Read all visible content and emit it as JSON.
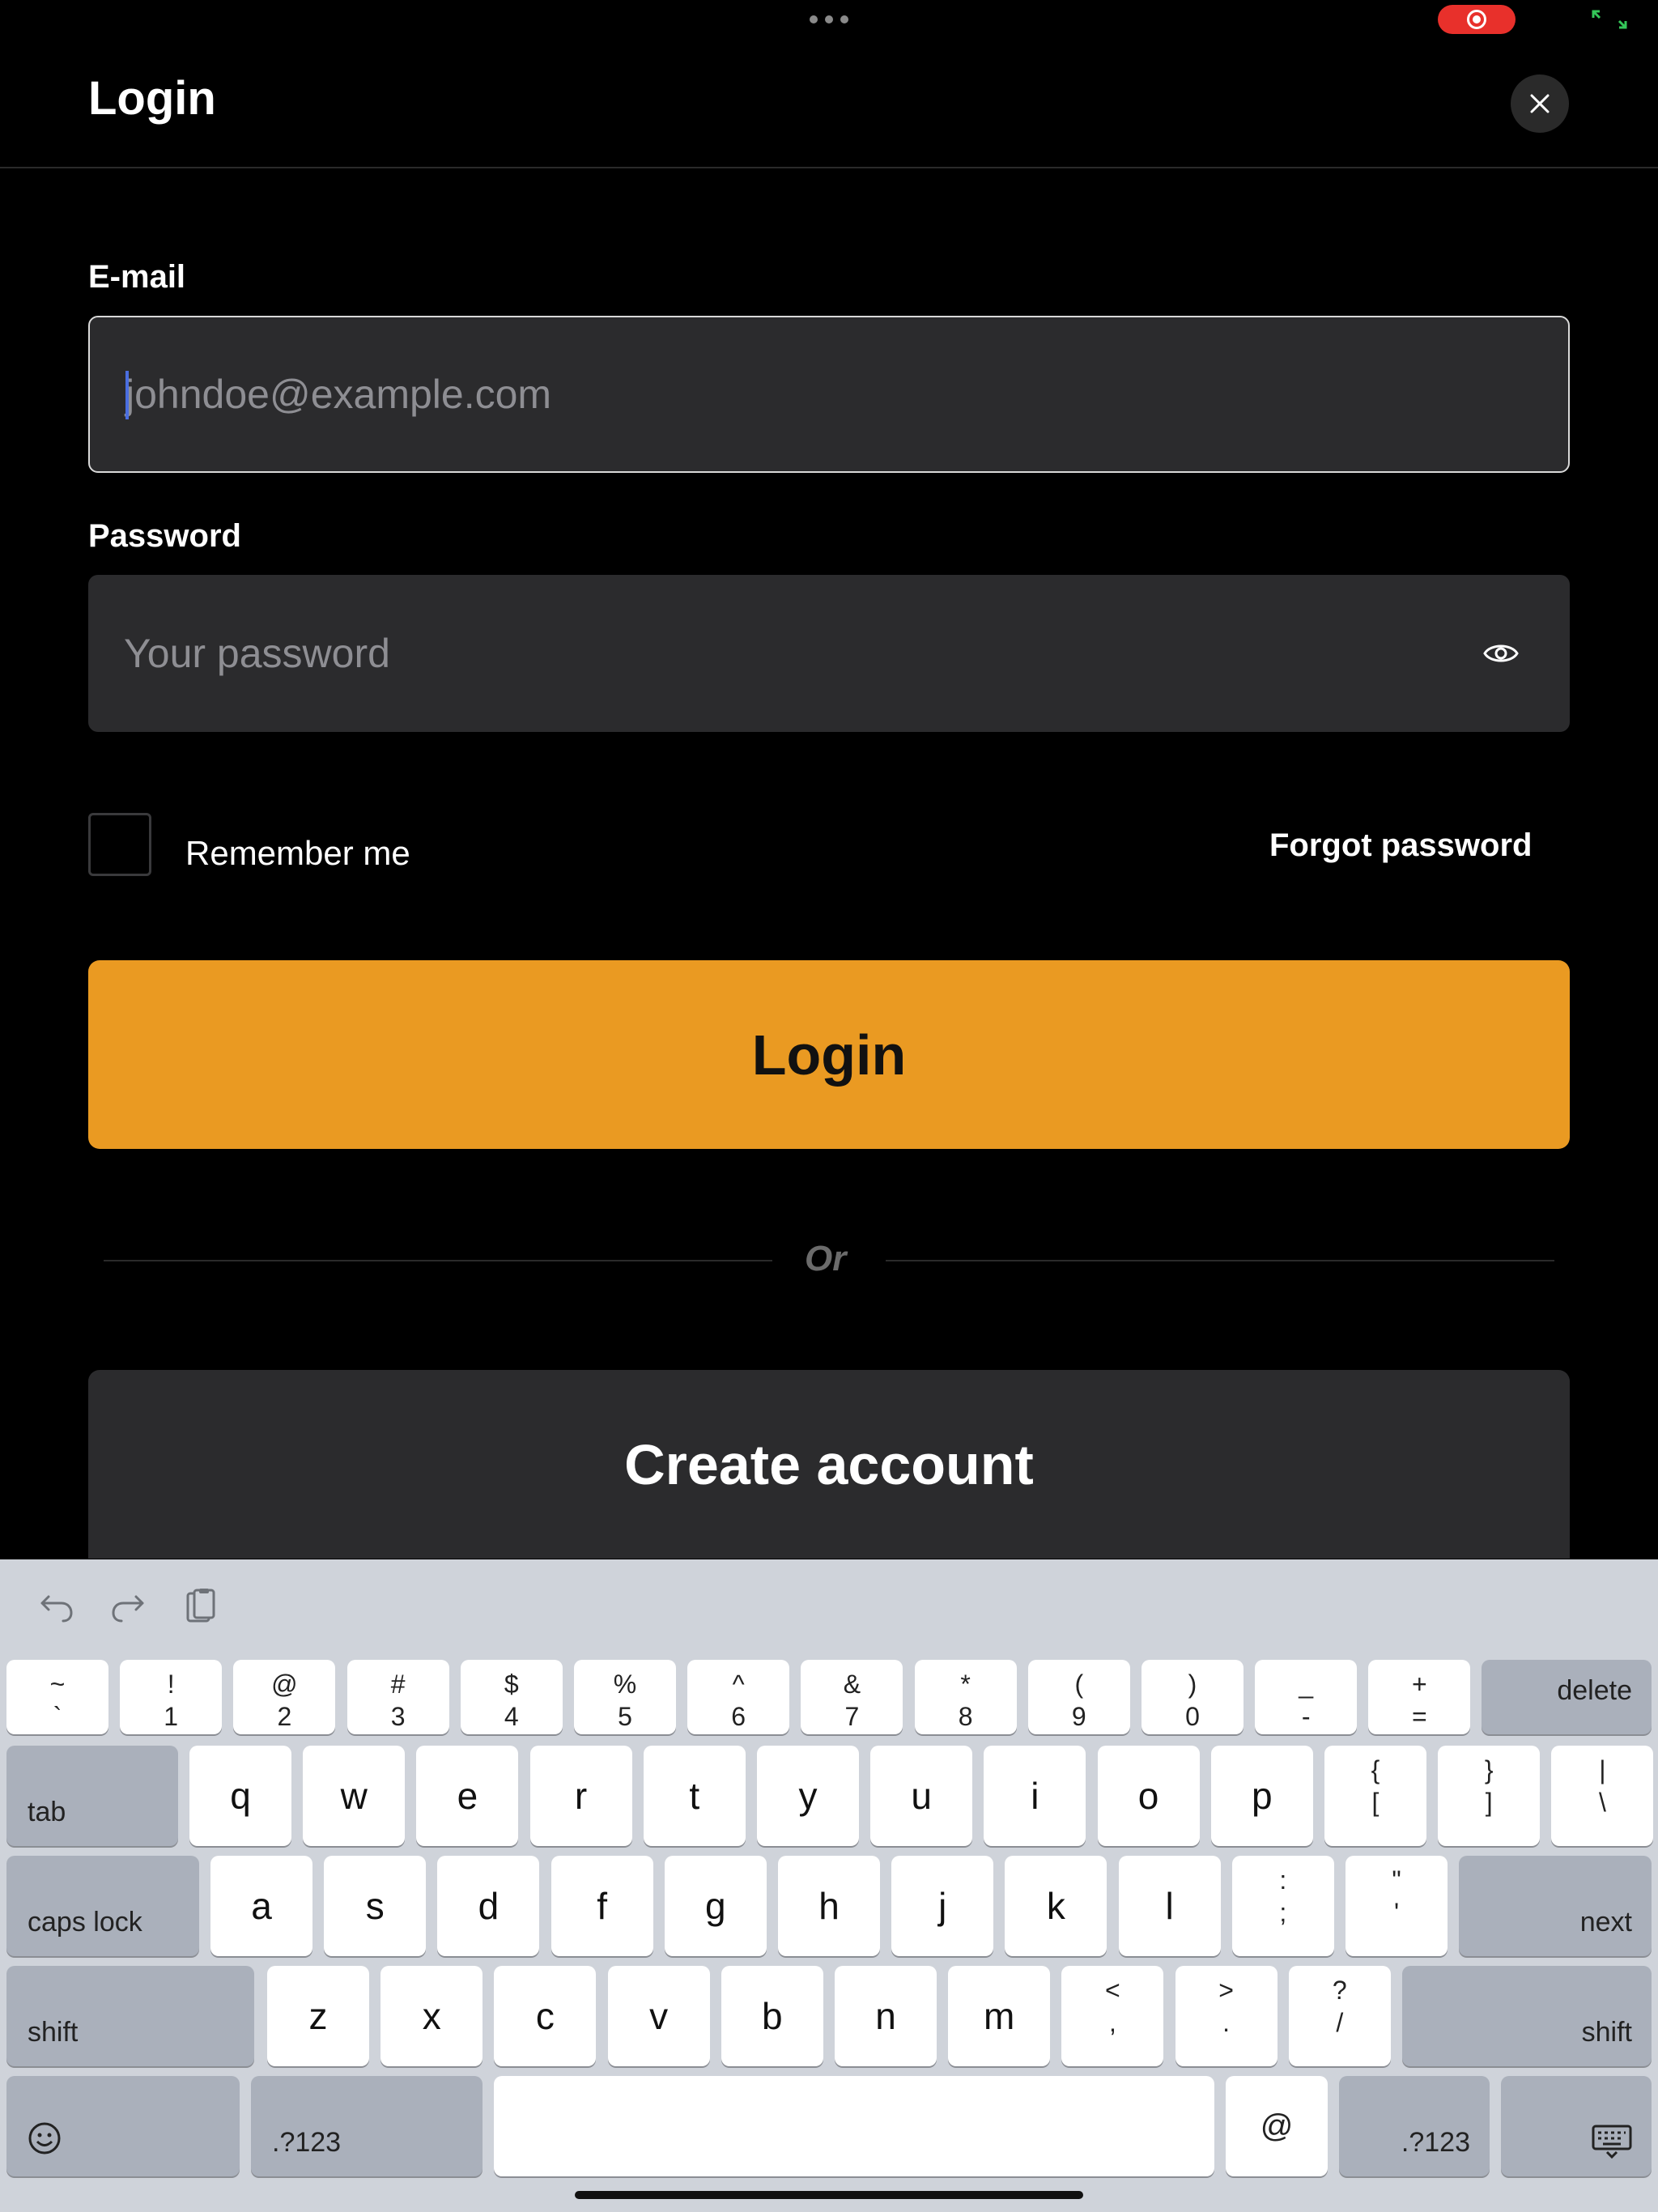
{
  "header": {
    "title": "Login"
  },
  "form": {
    "email_label": "E-mail",
    "email_placeholder": "johndoe@example.com",
    "password_label": "Password",
    "password_placeholder": "Your password",
    "remember_label": "Remember me",
    "forgot_label": "Forgot password",
    "login_label": "Login",
    "or_label": "Or",
    "create_label": "Create account"
  },
  "keyboard": {
    "row1": [
      {
        "top": "~",
        "bot": "`"
      },
      {
        "top": "!",
        "bot": "1"
      },
      {
        "top": "@",
        "bot": "2"
      },
      {
        "top": "#",
        "bot": "3"
      },
      {
        "top": "$",
        "bot": "4"
      },
      {
        "top": "%",
        "bot": "5"
      },
      {
        "top": "^",
        "bot": "6"
      },
      {
        "top": "&",
        "bot": "7"
      },
      {
        "top": "*",
        "bot": "8"
      },
      {
        "top": "(",
        "bot": "9"
      },
      {
        "top": ")",
        "bot": "0"
      },
      {
        "top": "_",
        "bot": "-"
      },
      {
        "top": "+",
        "bot": "="
      }
    ],
    "delete": "delete",
    "tab": "tab",
    "row2": [
      "q",
      "w",
      "e",
      "r",
      "t",
      "y",
      "u",
      "i",
      "o",
      "p"
    ],
    "row2_dual": [
      {
        "top": "{",
        "bot": "["
      },
      {
        "top": "}",
        "bot": "]"
      },
      {
        "top": "|",
        "bot": "\\"
      }
    ],
    "caps": "caps lock",
    "row3": [
      "a",
      "s",
      "d",
      "f",
      "g",
      "h",
      "j",
      "k",
      "l"
    ],
    "row3_dual": [
      {
        "top": ":",
        "bot": ";"
      },
      {
        "top": "\"",
        "bot": "'"
      }
    ],
    "next": "next",
    "shift": "shift",
    "row4": [
      "z",
      "x",
      "c",
      "v",
      "b",
      "n",
      "m"
    ],
    "row4_dual": [
      {
        "top": "<",
        "bot": ","
      },
      {
        "top": ">",
        "bot": "."
      },
      {
        "top": "?",
        "bot": "/"
      }
    ],
    "numbers_label": ".?123",
    "at_label": "@",
    "emoji_icon": "emoji-icon",
    "hide_icon": "keyboard-hide-icon"
  },
  "colors": {
    "accent": "#ea9a22",
    "field": "#2b2b2d",
    "background": "#000000"
  }
}
